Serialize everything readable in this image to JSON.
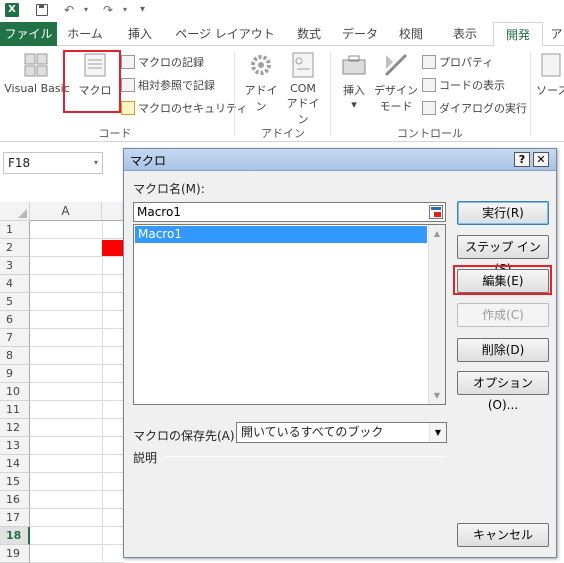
{
  "qat": {
    "app_icon": "X",
    "undo_icon": "↶",
    "redo_icon": "↷",
    "dropdown_glyph": "▾",
    "more_glyph": "▾"
  },
  "tabs": [
    {
      "label": "ファイル"
    },
    {
      "label": "ホーム"
    },
    {
      "label": "挿入"
    },
    {
      "label": "ページ レイアウト"
    },
    {
      "label": "数式"
    },
    {
      "label": "データ"
    },
    {
      "label": "校閲"
    },
    {
      "label": "表示"
    },
    {
      "label": "開発"
    },
    {
      "label": "ア"
    }
  ],
  "ribbon": {
    "code": {
      "visual_basic": "Visual Basic",
      "macro": "マクロ",
      "record_macro": "マクロの記録",
      "relative_ref": "相対参照で記録",
      "macro_security": "マクロのセキュリティ",
      "group_label": "コード"
    },
    "addins": {
      "addins": "アドイン",
      "com_addins_1": "COM",
      "com_addins_2": "アドイン",
      "group_label": "アドイン"
    },
    "controls": {
      "insert": "挿入",
      "design_mode_1": "デザイン",
      "design_mode_2": "モード",
      "properties": "プロパティ",
      "view_code": "コードの表示",
      "run_dialog": "ダイアログの実行",
      "group_label": "コントロール"
    },
    "source": "ソース"
  },
  "namebox": {
    "value": "F18"
  },
  "grid": {
    "column_a": "A",
    "rows": [
      "1",
      "2",
      "3",
      "4",
      "5",
      "6",
      "7",
      "8",
      "9",
      "10",
      "11",
      "12",
      "13",
      "14",
      "15",
      "16",
      "17",
      "18",
      "19"
    ],
    "active_row": "18",
    "highlight_color": "#ff0000"
  },
  "dialog": {
    "title": "マクロ",
    "help": "?",
    "close": "✕",
    "macro_name_label": "マクロ名(M):",
    "macro_name_value": "Macro1",
    "macros": [
      "Macro1"
    ],
    "buttons": {
      "run": "実行(R)",
      "step_in": "ステップ イン(S)",
      "edit": "編集(E)",
      "create": "作成(C)",
      "delete": "削除(D)",
      "options": "オプション(O)...",
      "cancel": "キャンセル"
    },
    "store_label": "マクロの保存先(A):",
    "store_value": "開いているすべてのブック",
    "description_label": "説明"
  },
  "colors": {
    "excel_green": "#217346",
    "highlight_red": "#e2222b",
    "selection_blue": "#3399ff"
  }
}
